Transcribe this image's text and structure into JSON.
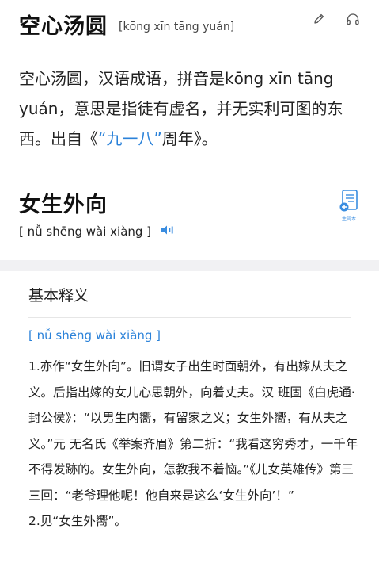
{
  "entry1": {
    "title": "空心汤圆",
    "pinyin": "[kōng xīn tāng yuán]",
    "body_before": "空心汤圆，汉语成语，拼音是kōng xīn tāng yuán，意思是指徒有虚名，并无实利可图的东西。出自《",
    "body_link": "“九一八”",
    "body_after": "周年》。"
  },
  "entry2": {
    "title": "女生外向",
    "pinyin": "[ nǚ shēng wài xiàng ]",
    "notebook_label": "生词本"
  },
  "section": {
    "title": "基本释义",
    "pinyin": "[ nǚ shēng wài xiàng ]",
    "definition": "1.亦作“女生外向”。旧谓女子出生时面朝外，有出嫁从夫之义。后指出嫁的女儿心思朝外，向着丈夫。汉 班固《白虎通·封公侯》：“以男生内嚮，有留家之义；女生外嚮，有从夫之义。”元 无名氏《举案齐眉》第二折：“我看这穷秀才，一千年不得发跡的。女生外向，怎教我不着恼。”《儿女英雄传》第三三回：“老爷理他呢！他自来是这么‘女生外向’！”",
    "definition2": "2.见“女生外嚮”。"
  },
  "icons": {
    "edit": "pencil-icon",
    "listen": "headphones-icon",
    "speaker": "speaker-icon",
    "notebook": "notebook-add-icon"
  },
  "colors": {
    "link": "#2b82d9",
    "separator": "#f1f1f3"
  }
}
